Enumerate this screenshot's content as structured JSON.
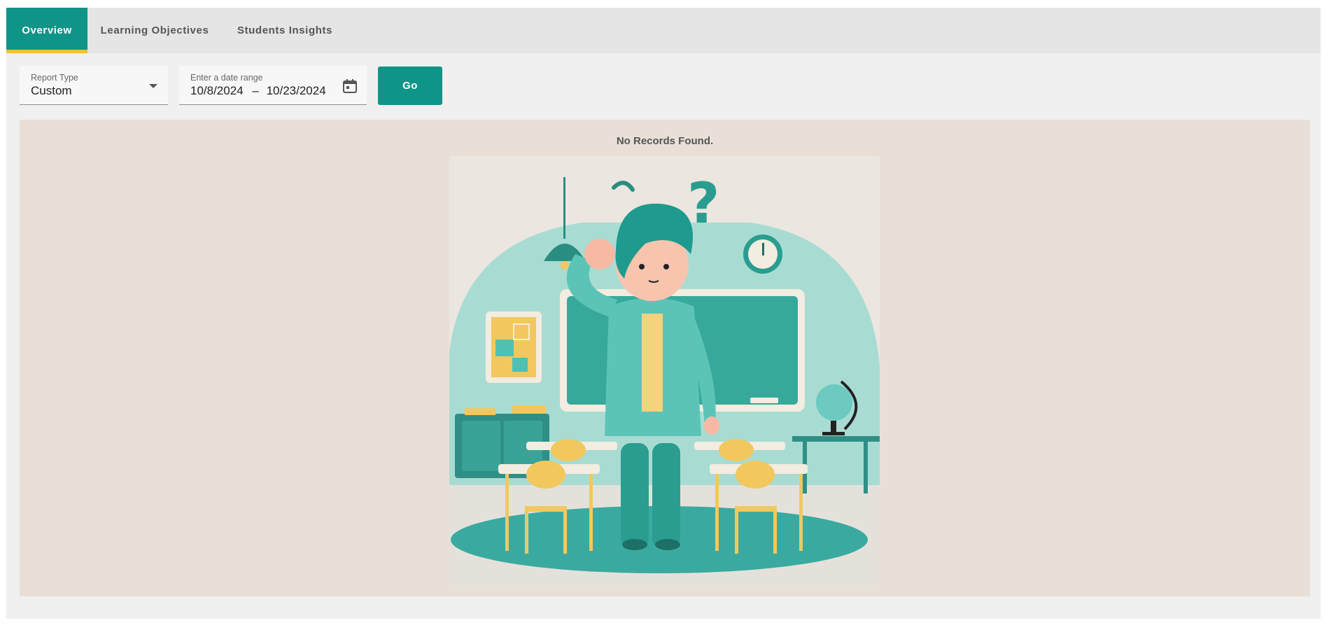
{
  "tabs": [
    {
      "label": "Overview",
      "active": true
    },
    {
      "label": "Learning Objectives",
      "active": false
    },
    {
      "label": "Students Insights",
      "active": false
    }
  ],
  "filters": {
    "report_type": {
      "label": "Report Type",
      "value": "Custom"
    },
    "date_range": {
      "label": "Enter a date range",
      "start": "10/8/2024",
      "separator": "–",
      "end": "10/23/2024"
    },
    "go_label": "Go"
  },
  "results": {
    "empty_message": "No Records Found.",
    "illustration": "confused-teacher-classroom"
  },
  "colors": {
    "accent": "#0f9488",
    "active_tab_underline": "#e8c730",
    "panel_bg": "#e8e0d6"
  }
}
